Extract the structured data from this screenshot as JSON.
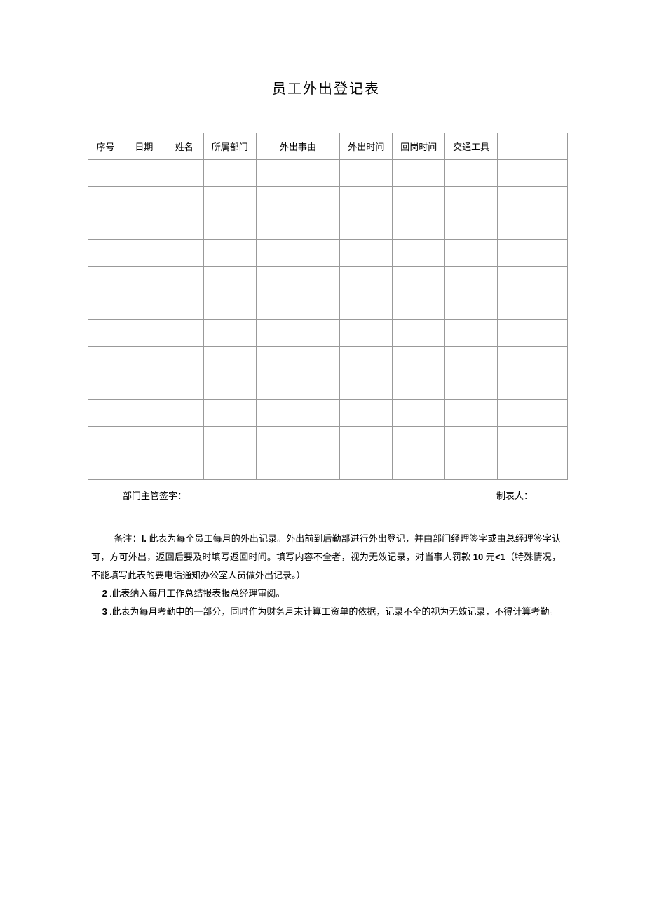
{
  "title": "员工外出登记表",
  "headers": {
    "seq": "序号",
    "date": "日期",
    "name": "姓名",
    "dept": "所属部门",
    "reason": "外出事由",
    "out_time": "外出时间",
    "back_time": "回岗时间",
    "transport": "交通工具",
    "extra": ""
  },
  "rows": [
    {
      "seq": "",
      "date": "",
      "name": "",
      "dept": "",
      "reason": "",
      "out": "",
      "back": "",
      "trans": "",
      "extra": ""
    },
    {
      "seq": "",
      "date": "",
      "name": "",
      "dept": "",
      "reason": "",
      "out": "",
      "back": "",
      "trans": "",
      "extra": ""
    },
    {
      "seq": "",
      "date": "",
      "name": "",
      "dept": "",
      "reason": "",
      "out": "",
      "back": "",
      "trans": "",
      "extra": ""
    },
    {
      "seq": "",
      "date": "",
      "name": "",
      "dept": "",
      "reason": "",
      "out": "",
      "back": "",
      "trans": "",
      "extra": ""
    },
    {
      "seq": "",
      "date": "",
      "name": "",
      "dept": "",
      "reason": "",
      "out": "",
      "back": "",
      "trans": "",
      "extra": ""
    },
    {
      "seq": "",
      "date": "",
      "name": "",
      "dept": "",
      "reason": "",
      "out": "",
      "back": "",
      "trans": "",
      "extra": ""
    },
    {
      "seq": "",
      "date": "",
      "name": "",
      "dept": "",
      "reason": "",
      "out": "",
      "back": "",
      "trans": "",
      "extra": ""
    },
    {
      "seq": "",
      "date": "",
      "name": "",
      "dept": "",
      "reason": "",
      "out": "",
      "back": "",
      "trans": "",
      "extra": ""
    },
    {
      "seq": "",
      "date": "",
      "name": "",
      "dept": "",
      "reason": "",
      "out": "",
      "back": "",
      "trans": "",
      "extra": ""
    },
    {
      "seq": "",
      "date": "",
      "name": "",
      "dept": "",
      "reason": "",
      "out": "",
      "back": "",
      "trans": "",
      "extra": ""
    },
    {
      "seq": "",
      "date": "",
      "name": "",
      "dept": "",
      "reason": "",
      "out": "",
      "back": "",
      "trans": "",
      "extra": ""
    },
    {
      "seq": "",
      "date": "",
      "name": "",
      "dept": "",
      "reason": "",
      "out": "",
      "back": "",
      "trans": "",
      "extra": ""
    }
  ],
  "signatures": {
    "supervisor": "部门主管签字：",
    "preparer": "制表人："
  },
  "notes": {
    "prefix": "备注：",
    "n1_label": "I.",
    "n1_text": " 此表为每个员工每月的外出记录。外出前到后勤部进行外出登记，并由部门经理签字或由总经理签字认可，方可外出，返回后要及时填写返回时间。填写内容不全者，视为无效记录，对当事人罚款 ",
    "n1_amount": "10",
    "n1_unit": " 元",
    "n1_lt": "<1",
    "n1_tail": "（特殊情况，不能填写此表的要电话通知办公室人员做外出记录。）",
    "n2_label": "2",
    "n2_text": " .此表纳入每月工作总结报表报总经理审阅。",
    "n3_label": "3",
    "n3_text": " .此表为每月考勤中的一部分，同时作为财务月末计算工资单的依据，记录不全的视为无效记录，不得计算考勤。"
  }
}
